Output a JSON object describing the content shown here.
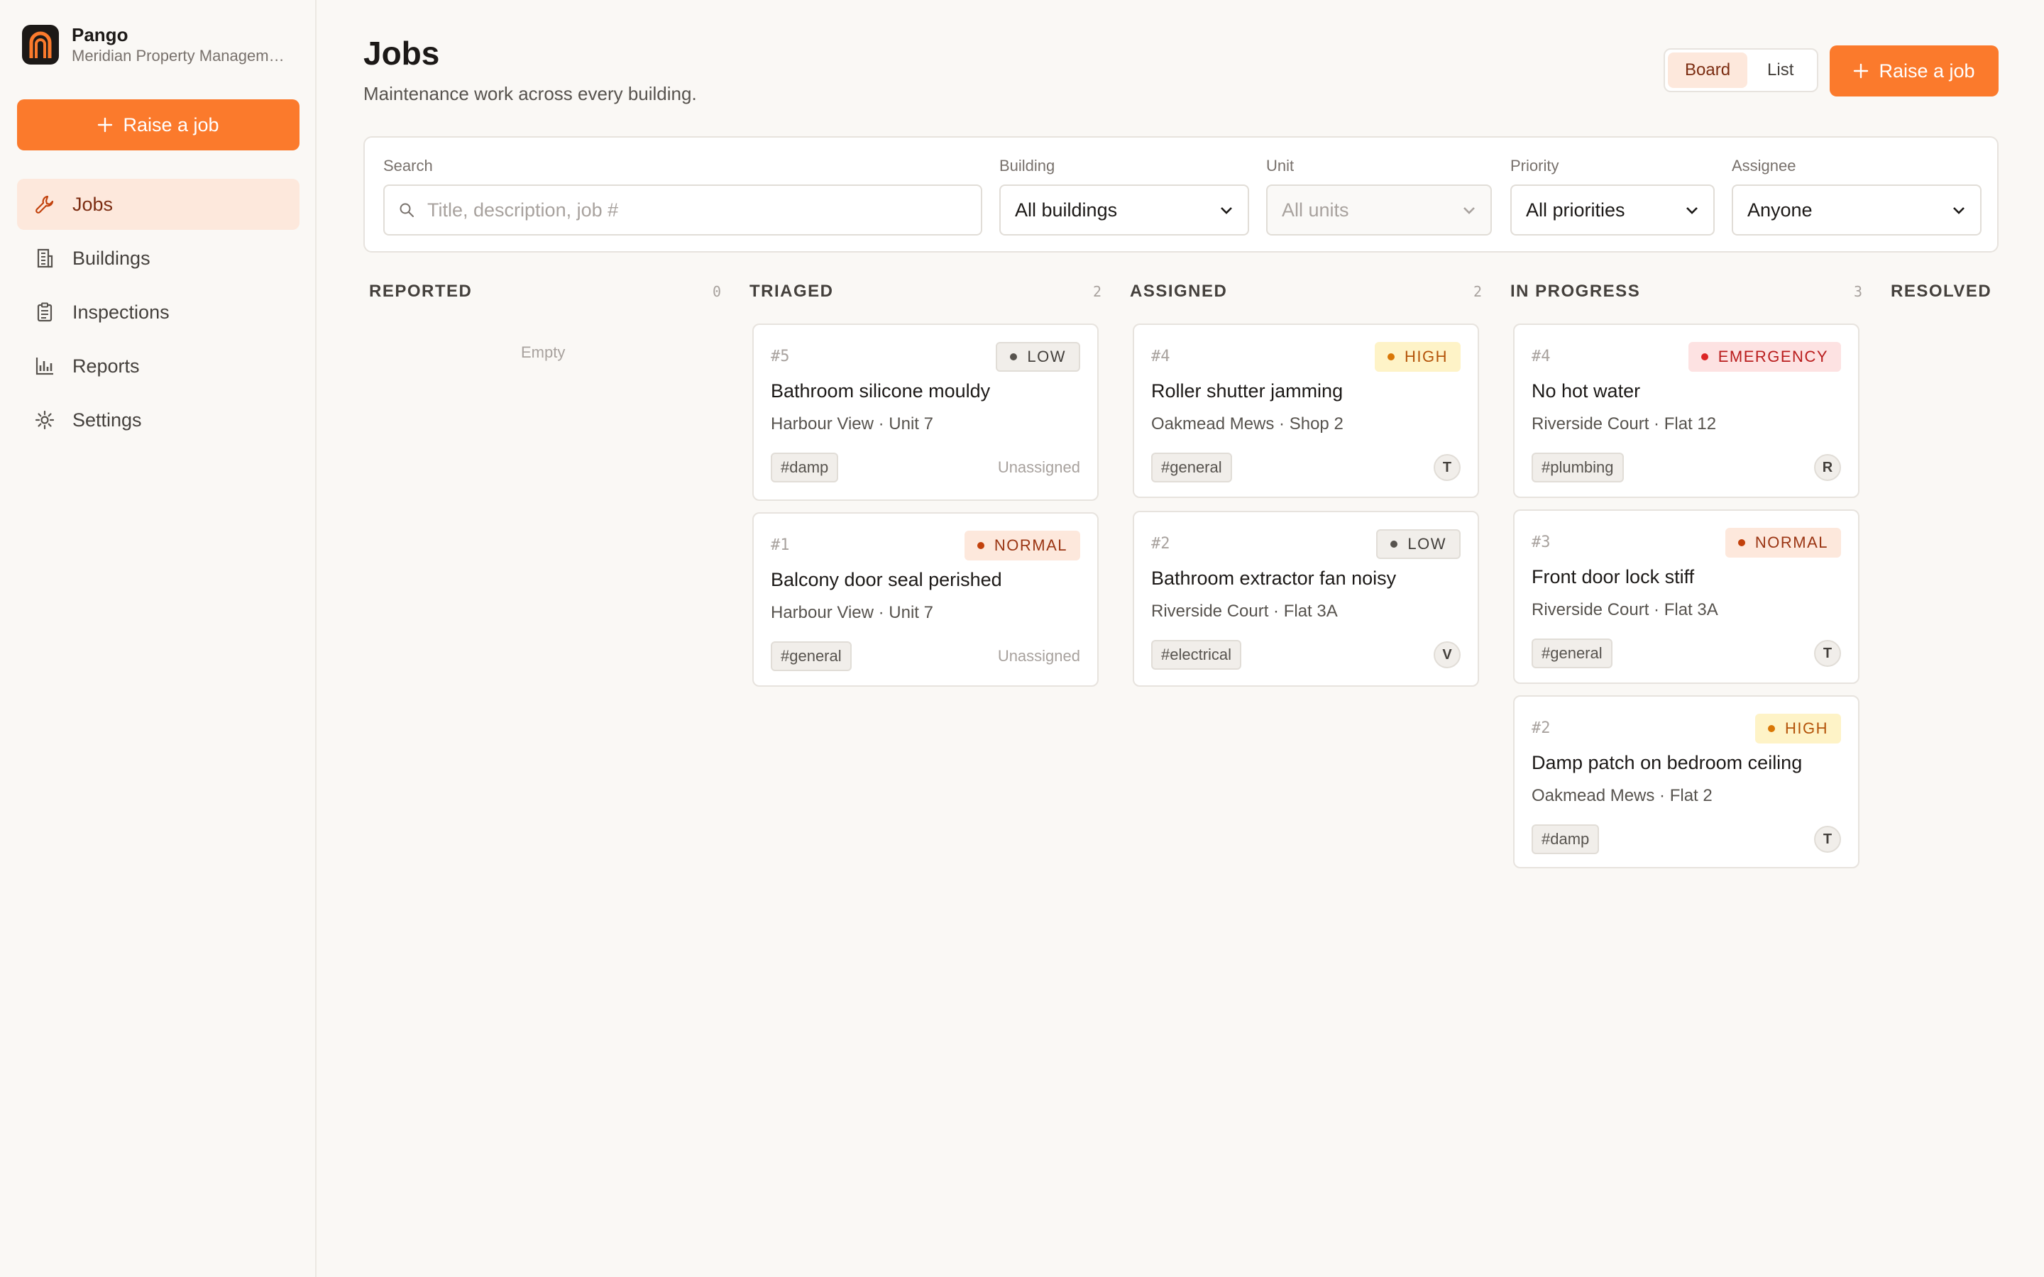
{
  "brand": {
    "name": "Pango",
    "org": "Meridian Property Management"
  },
  "sidebar": {
    "raise_label": "Raise a job",
    "items": [
      {
        "label": "Jobs",
        "icon": "wrench-icon"
      },
      {
        "label": "Buildings",
        "icon": "building-icon"
      },
      {
        "label": "Inspections",
        "icon": "clipboard-icon"
      },
      {
        "label": "Reports",
        "icon": "bar-chart-icon"
      },
      {
        "label": "Settings",
        "icon": "gear-icon"
      }
    ]
  },
  "header": {
    "title": "Jobs",
    "subtitle": "Maintenance work across every building.",
    "view_board": "Board",
    "view_list": "List",
    "raise_label": "Raise a job"
  },
  "filters": {
    "search": {
      "label": "Search",
      "placeholder": "Title, description, job #"
    },
    "building": {
      "label": "Building",
      "value": "All buildings"
    },
    "unit": {
      "label": "Unit",
      "value": "All units"
    },
    "priority": {
      "label": "Priority",
      "value": "All priorities"
    },
    "assignee": {
      "label": "Assignee",
      "value": "Anyone"
    }
  },
  "colors": {
    "accent": "#fb7a2c",
    "low": "#57534e",
    "normal": "#c2410c",
    "high": "#b45309",
    "emergency": "#dc2626"
  },
  "board": {
    "empty_label": "Empty",
    "columns": [
      {
        "title": "REPORTED",
        "count": "0"
      },
      {
        "title": "TRIAGED",
        "count": "2",
        "cards": [
          {
            "id": "#5",
            "priority": "LOW",
            "title": "Bathroom silicone mouldy",
            "location": "Harbour View · Unit 7",
            "tag": "#damp",
            "assignee": "Unassigned"
          },
          {
            "id": "#1",
            "priority": "NORMAL",
            "title": "Balcony door seal perished",
            "location": "Harbour View · Unit 7",
            "tag": "#general",
            "assignee": "Unassigned"
          }
        ]
      },
      {
        "title": "ASSIGNED",
        "count": "2",
        "cards": [
          {
            "id": "#4",
            "priority": "HIGH",
            "title": "Roller shutter jamming",
            "location": "Oakmead Mews · Shop 2",
            "tag": "#general",
            "assignee": "T"
          },
          {
            "id": "#2",
            "priority": "LOW",
            "title": "Bathroom extractor fan noisy",
            "location": "Riverside Court · Flat 3A",
            "tag": "#electrical",
            "assignee": "V"
          }
        ]
      },
      {
        "title": "IN PROGRESS",
        "count": "3",
        "cards": [
          {
            "id": "#4",
            "priority": "EMERGENCY",
            "title": "No hot water",
            "location": "Riverside Court · Flat 12",
            "tag": "#plumbing",
            "assignee": "R"
          },
          {
            "id": "#3",
            "priority": "NORMAL",
            "title": "Front door lock stiff",
            "location": "Riverside Court · Flat 3A",
            "tag": "#general",
            "assignee": "T"
          },
          {
            "id": "#2",
            "priority": "HIGH",
            "title": "Damp patch on bedroom ceiling",
            "location": "Oakmead Mews · Flat 2",
            "tag": "#damp",
            "assignee": "T"
          }
        ]
      },
      {
        "title": "RESOLVED",
        "count": ""
      }
    ]
  }
}
